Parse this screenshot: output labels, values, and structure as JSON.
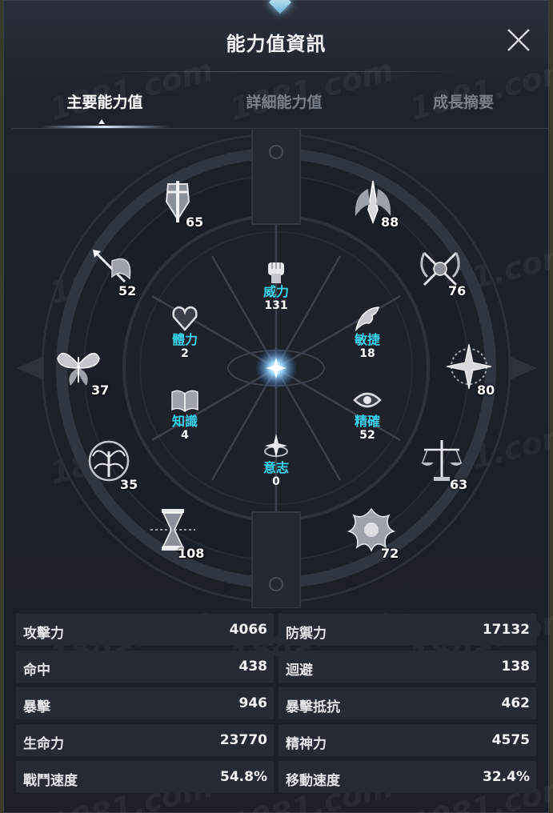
{
  "window": {
    "title": "能力值資訊"
  },
  "tabs": [
    {
      "label": "主要能力值",
      "active": true
    },
    {
      "label": "詳細能力值",
      "active": false
    },
    {
      "label": "成長摘要",
      "active": false
    }
  ],
  "watermark": "1881.com",
  "emblems": [
    {
      "icon": "sword-shield-emblem-icon",
      "value": "65"
    },
    {
      "icon": "winged-blade-emblem-icon",
      "value": "88"
    },
    {
      "icon": "arrow-wing-emblem-icon",
      "value": "52"
    },
    {
      "icon": "crossed-scythes-emblem-icon",
      "value": "76"
    },
    {
      "icon": "butterfly-emblem-icon",
      "value": "37"
    },
    {
      "icon": "compass-star-emblem-icon",
      "value": "80"
    },
    {
      "icon": "tree-of-life-emblem-icon",
      "value": "35"
    },
    {
      "icon": "scales-emblem-icon",
      "value": "63"
    },
    {
      "icon": "hourglass-emblem-icon",
      "value": "108"
    },
    {
      "icon": "flame-sun-emblem-icon",
      "value": "72"
    }
  ],
  "core_stats": [
    {
      "name": "威力",
      "value": "131",
      "icon": "fist-icon"
    },
    {
      "name": "體力",
      "value": "2",
      "icon": "heart-icon"
    },
    {
      "name": "敏捷",
      "value": "18",
      "icon": "feather-wing-icon"
    },
    {
      "name": "知識",
      "value": "4",
      "icon": "book-icon"
    },
    {
      "name": "精確",
      "value": "52",
      "icon": "eye-icon"
    },
    {
      "name": "意志",
      "value": "0",
      "icon": "spark-ring-icon"
    }
  ],
  "stats": [
    {
      "label": "攻擊力",
      "value": "4066"
    },
    {
      "label": "防禦力",
      "value": "17132"
    },
    {
      "label": "命中",
      "value": "438"
    },
    {
      "label": "迴避",
      "value": "138"
    },
    {
      "label": "暴擊",
      "value": "946"
    },
    {
      "label": "暴擊抵抗",
      "value": "462"
    },
    {
      "label": "生命力",
      "value": "23770"
    },
    {
      "label": "精神力",
      "value": "4575"
    },
    {
      "label": "戰鬥速度",
      "value": "54.8%"
    },
    {
      "label": "移動速度",
      "value": "32.4%"
    }
  ],
  "colors": {
    "core_stat_name": "#35d6f0",
    "panel_bg": "#1b1f28"
  }
}
